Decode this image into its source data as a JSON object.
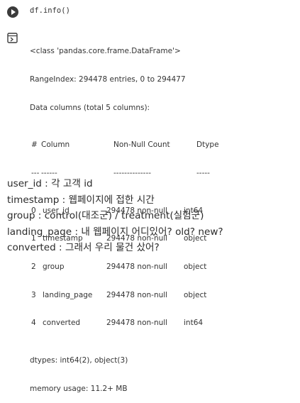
{
  "cell": {
    "code": "df.info()"
  },
  "output": {
    "lines_top": [
      "<class 'pandas.core.frame.DataFrame'>",
      "RangeIndex: 294478 entries, 0 to 294477",
      "Data columns (total 5 columns):"
    ],
    "header": {
      "idx": "#",
      "column": "Column",
      "nonnull": "Non-Null Count",
      "dtype": "Dtype"
    },
    "separator": {
      "idx": "---",
      "column": "------",
      "nonnull": "--------------",
      "dtype": "-----"
    },
    "rows": [
      {
        "idx": "0",
        "column": "user_id",
        "nonnull": "294478 non-null",
        "dtype": "int64"
      },
      {
        "idx": "1",
        "column": "timestamp",
        "nonnull": "294478 non-null",
        "dtype": "object"
      },
      {
        "idx": "2",
        "column": "group",
        "nonnull": "294478 non-null",
        "dtype": "object"
      },
      {
        "idx": "3",
        "column": "landing_page",
        "nonnull": "294478 non-null",
        "dtype": "object"
      },
      {
        "idx": "4",
        "column": "converted",
        "nonnull": "294478 non-null",
        "dtype": "int64"
      }
    ],
    "dtypes": "dtypes: int64(2), object(3)",
    "memory": "memory usage: 11.2+ MB"
  },
  "notes": [
    "user_id : 각 고객 id",
    "timestamp : 웹페이지에 접한 시간",
    "group : control(대조군) / treatment(실험군)",
    "landing_page : 내 웹페이지 어디있어? old? new?",
    "converted : 그래서 우리 물건 샀어?"
  ]
}
